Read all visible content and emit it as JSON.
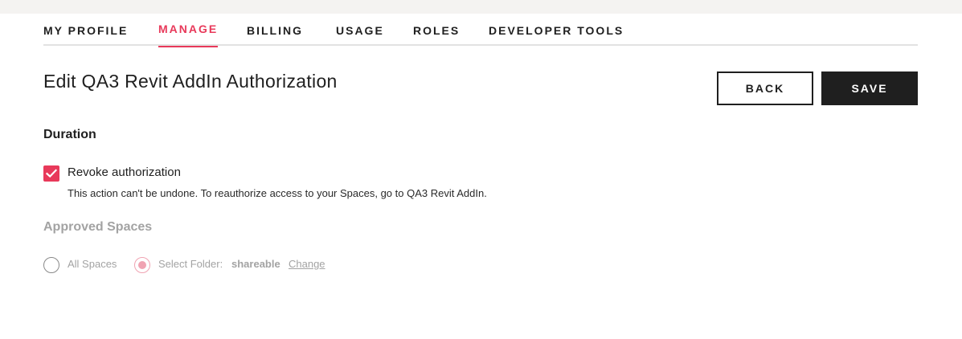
{
  "tabs": [
    {
      "label": "MY PROFILE",
      "active": false
    },
    {
      "label": "MANAGE",
      "active": true
    },
    {
      "label": "BILLING",
      "active": false
    },
    {
      "label": "USAGE",
      "active": false
    },
    {
      "label": "ROLES",
      "active": false
    },
    {
      "label": "DEVELOPER TOOLS",
      "active": false
    }
  ],
  "page": {
    "title": "Edit QA3 Revit AddIn Authorization"
  },
  "actions": {
    "back_label": "BACK",
    "save_label": "SAVE"
  },
  "duration": {
    "title": "Duration",
    "revoke_label": "Revoke authorization",
    "revoke_checked": true,
    "help_text": "This action can't be undone. To reauthorize access to your Spaces, go to QA3 Revit AddIn."
  },
  "approved_spaces": {
    "title": "Approved Spaces",
    "options": [
      {
        "label": "All Spaces",
        "selected": false
      },
      {
        "label": "Select Folder:",
        "selected": true
      }
    ],
    "folder_name": "shareable",
    "change_label": "Change",
    "disabled": true
  },
  "colors": {
    "accent": "#e8395a",
    "dark": "#1f1f1f",
    "muted": "#a3a3a3",
    "strip": "#f4f3f1"
  },
  "icons": {
    "checkbox": "checkmark-icon"
  }
}
